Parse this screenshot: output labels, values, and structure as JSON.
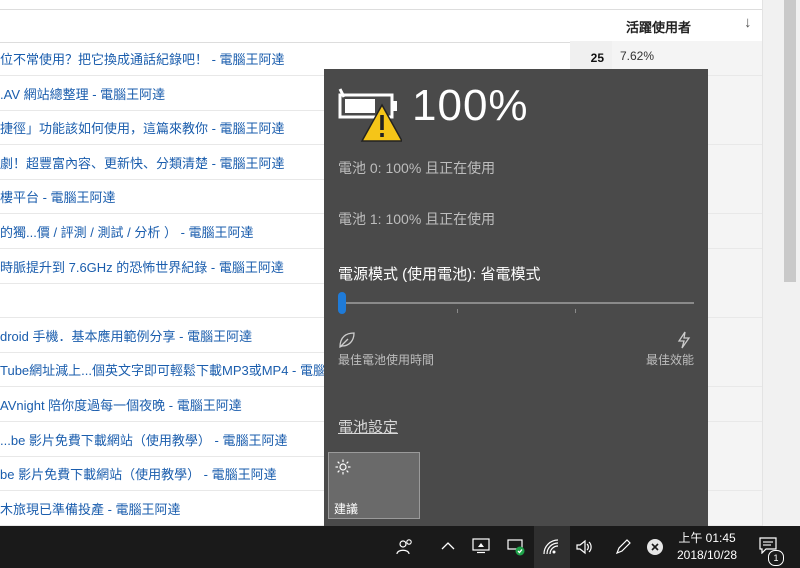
{
  "table": {
    "column_header": "活躍使用者",
    "rows": [
      {
        "title": "位不常使用？把它換成通話紀錄吧！ - 電腦王阿達",
        "count": "25",
        "percent": "7.62%"
      },
      {
        "title": ".AV 網站總整理 - 電腦王阿達",
        "count": "",
        "percent": ""
      },
      {
        "title": "捷徑」功能該如何使用，這篇來教你 - 電腦王阿達",
        "count": "",
        "percent": ""
      },
      {
        "title": "劇！超豐富內容、更新快、分類清楚 - 電腦王阿達",
        "count": "",
        "percent": ""
      },
      {
        "title": "樓平台 - 電腦王阿達",
        "count": "",
        "percent": ""
      },
      {
        "title": "的獨...價 / 評測 / 測試 / 分析 ） - 電腦王阿達",
        "count": "",
        "percent": ""
      },
      {
        "title": "時脈提升到 7.6GHz 的恐怖世界紀錄 - 電腦王阿達",
        "count": "",
        "percent": ""
      },
      {
        "title": "",
        "count": "",
        "percent": ""
      },
      {
        "title": "droid 手機．基本應用範例分享 - 電腦王阿達",
        "count": "",
        "percent": ""
      },
      {
        "title": "Tube網址減上...個英文字即可輕鬆下載MP3或MP4 - 電腦",
        "count": "",
        "percent": ""
      },
      {
        "title": "AVnight 陪你度過每一個夜晚 - 電腦王阿達",
        "count": "",
        "percent": ""
      },
      {
        "title": "...be 影片免費下載網站（使用教學） - 電腦王阿達",
        "count": "",
        "percent": ""
      },
      {
        "title": "be 影片免費下載網站（使用教學） - 電腦王阿達",
        "count": "",
        "percent": ""
      },
      {
        "title": "木旅現已準備投產 - 電腦王阿達",
        "count": "",
        "percent": ""
      }
    ]
  },
  "battery": {
    "percent": "100%",
    "battery0": "電池 0: 100% 且正在使用",
    "battery1": "電池 1: 100% 且正在使用",
    "power_mode": "電源模式 (使用電池): 省電模式",
    "slider_level": 0.0,
    "best_life": "最佳電池使用時間",
    "best_perf": "最佳效能",
    "settings_link": "電池設定",
    "tile_label": "建議"
  },
  "taskbar": {
    "time": "上午 01:45",
    "date": "2018/10/28",
    "notification_count": "1",
    "icons": [
      "people-icon",
      "chevron-up-icon",
      "display-icon",
      "wifi-secure-icon",
      "wifi-icon",
      "volume-icon",
      "pen-icon",
      "close-circle-icon",
      "notification-icon"
    ]
  },
  "colors": {
    "flyout_bg": "#4a4a4a",
    "accent": "#1f7bd8",
    "warning": "#f5c518",
    "link": "#1a5dad"
  }
}
